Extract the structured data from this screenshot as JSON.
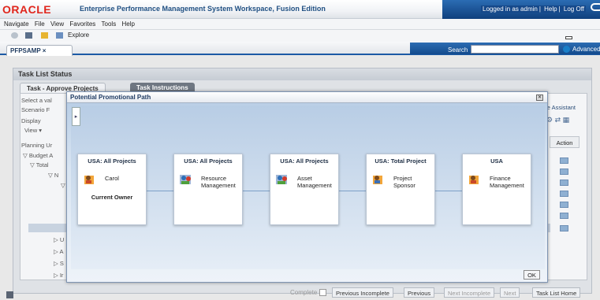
{
  "header": {
    "logo": "ORACLE",
    "app_title": "Enterprise Performance Management System Workspace, Fusion Edition",
    "logged_in": "Logged in as admin",
    "help": "Help",
    "logoff": "Log Off"
  },
  "menu": {
    "items": [
      "Navigate",
      "File",
      "View",
      "Favorites",
      "Tools",
      "Help"
    ]
  },
  "toolbar": {
    "explore": "Explore"
  },
  "doc_tab": {
    "label": "PFPSAMP"
  },
  "search": {
    "label": "Search",
    "value": "",
    "advanced": "Advanced"
  },
  "panel": {
    "title": "Task List Status",
    "tab1": "Task - Approve Projects",
    "tab2": "Task Instructions",
    "select_text": "Select a val",
    "scenario_text": "Scenario  F",
    "display_text": "Display",
    "view_text": "View ▾",
    "planning_text": "Planning Ur",
    "budget_text": "▽ Budget A",
    "total_text": "▽ Total",
    "n_text": "▽ N",
    "v_text": "▽",
    "rows": [
      "▷ U",
      "▷ A",
      "▷ S",
      "▷ Ir"
    ],
    "ce_text": "ce Assistant",
    "action_label": "Action"
  },
  "bottom": {
    "complete": "Complete",
    "prev_incomplete": "Previous Incomplete",
    "previous": "Previous",
    "next_incomplete": "Next Incomplete",
    "next": "Next",
    "task_list_home": "Task List Home"
  },
  "modal": {
    "title": "Potential Promotional Path",
    "ok": "OK",
    "nodes": [
      {
        "title": "USA: All Projects",
        "label": "Carol",
        "owner": "Current Owner"
      },
      {
        "title": "USA: All Projects",
        "label": "Resource Management",
        "owner": ""
      },
      {
        "title": "USA: All Projects",
        "label": "Asset Management",
        "owner": ""
      },
      {
        "title": "USA: Total Project",
        "label": "Project Sponsor",
        "owner": ""
      },
      {
        "title": "USA",
        "label": "Finance Management",
        "owner": ""
      }
    ]
  },
  "colors": {
    "brand_red": "#e0261c",
    "header_blue": "#1c5aa5"
  }
}
